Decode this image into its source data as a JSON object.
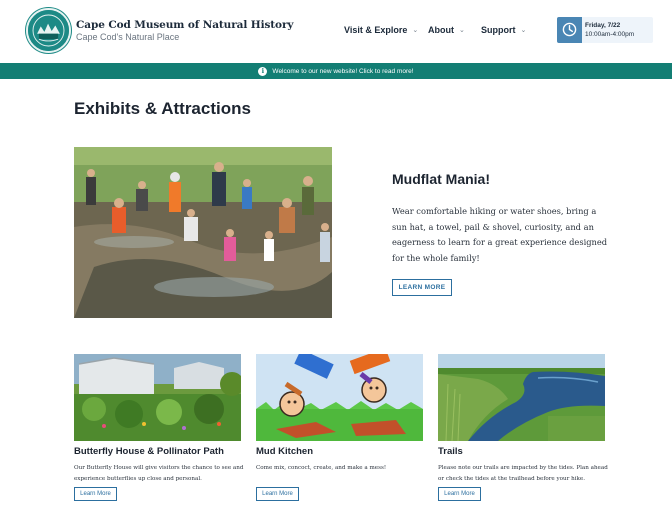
{
  "header": {
    "brand_title": "Cape Cod Museum of Natural History",
    "brand_tagline": "Cape Cod's Natural Place",
    "nav": [
      {
        "label": "Visit & Explore"
      },
      {
        "label": "About"
      },
      {
        "label": "Support"
      }
    ],
    "hours": {
      "day": "Friday, 7/22",
      "time": "10:00am-4:00pm"
    }
  },
  "announcement": {
    "text": "Welcome to our new website! Click to read more!"
  },
  "main": {
    "title": "Exhibits & Attractions",
    "featured": {
      "title": "Mudflat Mania!",
      "description": "Wear comfortable hiking or water shoes, bring a sun hat, a towel, pail & shovel, curiosity, and an eagerness to learn for a great experience designed for the whole family!",
      "button": "LEARN MORE"
    },
    "cards": [
      {
        "title": "Butterfly House & Pollinator Path",
        "description": "Our Butterfly House will give visitors the chance to see and experience butterflies up close and personal.",
        "button": "Learn More"
      },
      {
        "title": "Mud Kitchen",
        "description": "Come mix, concoct, create, and make a mess!",
        "button": "Learn More"
      },
      {
        "title": "Trails",
        "description": "Please note our trails are impacted by the tides. Plan ahead or check the tides at the trailhead before your hike.",
        "button": "Learn More"
      }
    ]
  },
  "colors": {
    "accent_teal": "#137e74",
    "link_blue": "#2c6f9f",
    "clock_blue": "#4a86b4"
  },
  "icons": [
    "museum-logo",
    "chevron-down-icon",
    "clock-icon",
    "info-icon"
  ]
}
